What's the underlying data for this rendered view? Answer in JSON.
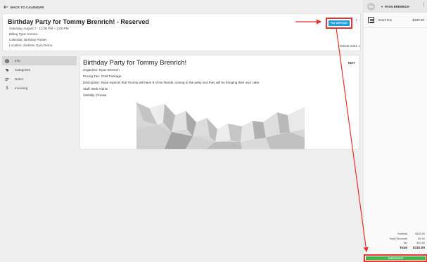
{
  "nav": {
    "back_label": "BACK TO CALENDAR"
  },
  "event": {
    "title": "Birthday Party for Tommy Brenrich! - Reserved",
    "datetime": "Saturday, August 7  ·  12:00 PM – 2:00 PM",
    "billing": "Billing Type: Invoice",
    "calendar": "Calendar: Birthday Parties",
    "location": "Location: Jackson Gym Demo",
    "tickets": "Tickets Sold: 1",
    "pay_label": "PAY DEPOSIT"
  },
  "sidenav": {
    "items": [
      {
        "label": "Info",
        "icon": "info-icon",
        "active": true
      },
      {
        "label": "Categories",
        "icon": "tag-icon",
        "active": false
      },
      {
        "label": "Notes",
        "icon": "notes-icon",
        "active": false
      },
      {
        "label": "Invoicing",
        "icon": "dollar-icon",
        "active": false
      }
    ]
  },
  "content": {
    "title": "Birthday Party for Tommy Brenrich!",
    "edit_label": "EDIT",
    "organizer": "Organizer: Ryan Brenrich",
    "pricing": "Pricing Tier: Gold Package",
    "description": "Description:  Ryan expects that Tommy will have 9 of his friends coming to the party and they will be bringing their own cake.",
    "staff": "Staff: Web Admin",
    "visibility": "Visibility: Private"
  },
  "sidebar": {
    "avatar_initials": "RB",
    "user_name": "RYAN BRENRICH",
    "line_items": [
      {
        "label": "Event Fee",
        "price": "$100.00"
      }
    ],
    "totals": {
      "subtotal_label": "Subtotal",
      "subtotal": "$100.00",
      "discounts_label": "Total Discounts",
      "discounts": "-$0.00",
      "tax_label": "Tax",
      "tax": "$10.00",
      "total_label": "Total",
      "total": "$110.00"
    },
    "checkout_label": "CHECKOUT"
  },
  "colors": {
    "accent_blue": "#1aa1e4",
    "checkout_green": "#3dbb4a",
    "highlight_red": "#e8322a"
  }
}
